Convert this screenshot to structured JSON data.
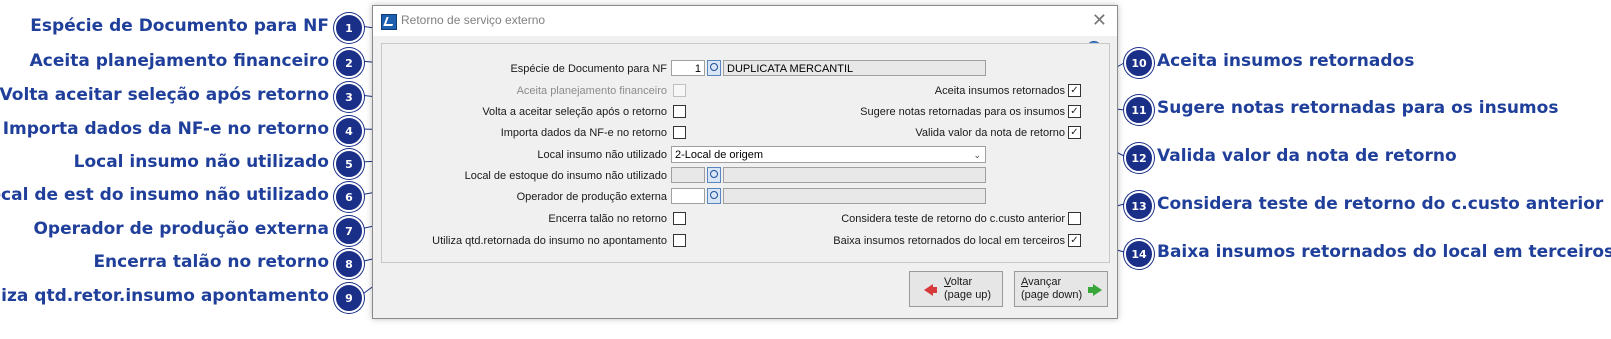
{
  "dialog": {
    "title": "Retorno de serviço externo",
    "close_symbol": "✕",
    "help_symbol": "?"
  },
  "form": {
    "especie_label": "Espécie de Documento para NF",
    "especie_code": "1",
    "especie_desc": "DUPLICATA MERCANTIL",
    "aceita_planejamento_label": "Aceita planejamento financeiro",
    "aceita_planejamento_checked": false,
    "volta_aceitar_label": "Volta a aceitar seleção após o retorno",
    "volta_aceitar_checked": false,
    "importa_dados_label": "Importa dados da NF-e no retorno",
    "importa_dados_checked": false,
    "local_insumo_label": "Local insumo não utilizado",
    "local_insumo_value": "2-Local de origem",
    "local_estoque_label": "Local de estoque do insumo não utilizado",
    "local_estoque_code": "",
    "local_estoque_desc": "",
    "operador_label": "Operador de produção externa",
    "operador_code": "",
    "operador_desc": "",
    "encerra_label": "Encerra talão no retorno",
    "encerra_checked": false,
    "utiliza_qtd_label": "Utiliza qtd.retornada do insumo no apontamento",
    "utiliza_qtd_checked": false,
    "aceita_insumos_label": "Aceita insumos retornados",
    "aceita_insumos_checked": true,
    "sugere_notas_label": "Sugere notas retornadas para os insumos",
    "sugere_notas_checked": true,
    "valida_valor_label": "Valida valor da nota de retorno",
    "valida_valor_checked": true,
    "considera_teste_label": "Considera teste de retorno do c.custo anterior",
    "considera_teste_checked": false,
    "baixa_insumos_label": "Baixa insumos retornados do local em terceiros",
    "baixa_insumos_checked": true,
    "check_mark": "✓",
    "dropdown_arrow": "⌄"
  },
  "buttons": {
    "voltar_key": "V",
    "voltar_rest": "oltar",
    "voltar_sub": "(page up)",
    "avancar_key": "A",
    "avancar_rest": "vançar",
    "avancar_sub": "(page down)"
  },
  "callouts": [
    {
      "num": "1",
      "text": "Espécie de Documento para NF"
    },
    {
      "num": "2",
      "text": "Aceita planejamento financeiro"
    },
    {
      "num": "3",
      "text": "Volta aceitar seleção após retorno"
    },
    {
      "num": "4",
      "text": "Importa dados da NF-e no retorno"
    },
    {
      "num": "5",
      "text": "Local insumo não utilizado"
    },
    {
      "num": "6",
      "text": "Local de est do insumo não utilizado"
    },
    {
      "num": "7",
      "text": "Operador de produção externa"
    },
    {
      "num": "8",
      "text": "Encerra talão no retorno"
    },
    {
      "num": "9",
      "text": "Utiliza qtd.retor.insumo apontamento"
    },
    {
      "num": "10",
      "text": "Aceita insumos retornados"
    },
    {
      "num": "11",
      "text": "Sugere notas retornadas para os insumos"
    },
    {
      "num": "12",
      "text": "Valida valor da nota de retorno"
    },
    {
      "num": "13",
      "text": "Considera teste de retorno do c.custo anterior"
    },
    {
      "num": "14",
      "text": "Baixa insumos retornados do local em terceiros"
    }
  ]
}
